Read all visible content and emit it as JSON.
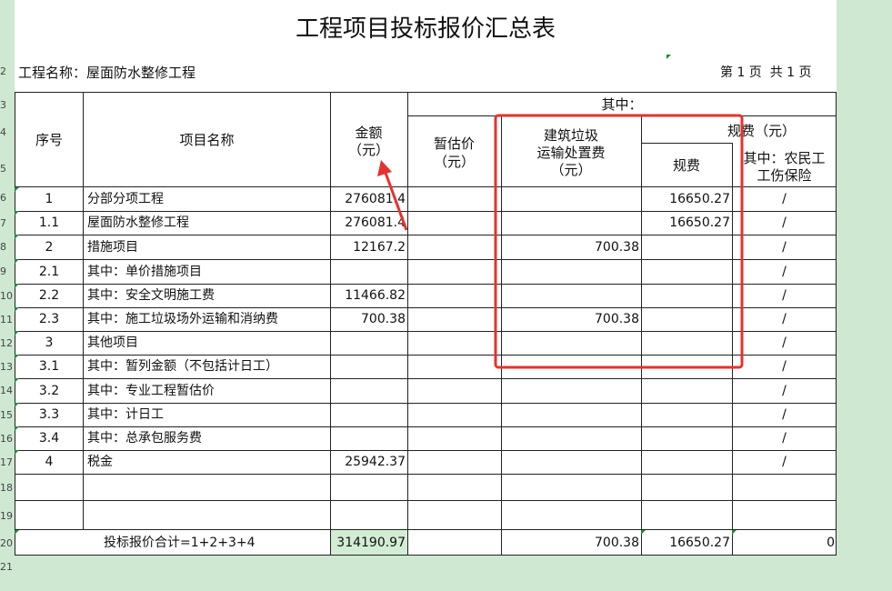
{
  "title": "工程项目投标报价汇总表",
  "project_name": "工程名称：屋面防水整修工程",
  "page_info": "第 1 页  共 1 页",
  "row_numbers": [
    "2",
    "3",
    "4",
    "5",
    "6",
    "7",
    "8",
    "9",
    "10",
    "11",
    "12",
    "13",
    "14",
    "15",
    "16",
    "17",
    "18",
    "19",
    "20",
    "21"
  ],
  "headers": {
    "seq": "序号",
    "item": "项目名称",
    "amount_l1": "金额",
    "amount_l2": "（元）",
    "among": "其中：",
    "provisional_l1": "暂估价",
    "provisional_l2": "（元）",
    "waste_l1": "建筑垃圾",
    "waste_l2": "运输处置费",
    "waste_l3": "（元）",
    "fees_group": "规费（元）",
    "fees": "规费",
    "injury_l1": "其中：农民工",
    "injury_l2": "工伤保险"
  },
  "rows": [
    {
      "seq": "1",
      "name": "分部分项工程",
      "amount": "276081.4",
      "prov": "",
      "waste": "",
      "fee": "16650.27",
      "inj": "/"
    },
    {
      "seq": "1.1",
      "name": "屋面防水整修工程",
      "amount": "276081.4",
      "prov": "",
      "waste": "",
      "fee": "16650.27",
      "inj": "/"
    },
    {
      "seq": "2",
      "name": "措施项目",
      "amount": "12167.2",
      "prov": "",
      "waste": "700.38",
      "fee": "",
      "inj": "/"
    },
    {
      "seq": "2.1",
      "name": "其中：单价措施项目",
      "amount": "",
      "prov": "",
      "waste": "",
      "fee": "",
      "inj": "/"
    },
    {
      "seq": "2.2",
      "name": "其中：安全文明施工费",
      "amount": "11466.82",
      "prov": "",
      "waste": "",
      "fee": "",
      "inj": "/"
    },
    {
      "seq": "2.3",
      "name": "其中：施工垃圾场外运输和消纳费",
      "amount": "700.38",
      "prov": "",
      "waste": "700.38",
      "fee": "",
      "inj": "/"
    },
    {
      "seq": "3",
      "name": "其他项目",
      "amount": "",
      "prov": "",
      "waste": "",
      "fee": "",
      "inj": "/"
    },
    {
      "seq": "3.1",
      "name": "其中：暂列金额（不包括计日工）",
      "amount": "",
      "prov": "",
      "waste": "",
      "fee": "",
      "inj": "/"
    },
    {
      "seq": "3.2",
      "name": "其中：专业工程暂估价",
      "amount": "",
      "prov": "",
      "waste": "",
      "fee": "",
      "inj": "/"
    },
    {
      "seq": "3.3",
      "name": "其中：计日工",
      "amount": "",
      "prov": "",
      "waste": "",
      "fee": "",
      "inj": "/"
    },
    {
      "seq": "3.4",
      "name": "其中：总承包服务费",
      "amount": "",
      "prov": "",
      "waste": "",
      "fee": "",
      "inj": "/"
    },
    {
      "seq": "4",
      "name": "税金",
      "amount": "25942.37",
      "prov": "",
      "waste": "",
      "fee": "",
      "inj": "/"
    },
    {
      "seq": "",
      "name": "",
      "amount": "",
      "prov": "",
      "waste": "",
      "fee": "",
      "inj": ""
    },
    {
      "seq": "",
      "name": "",
      "amount": "",
      "prov": "",
      "waste": "",
      "fee": "",
      "inj": ""
    }
  ],
  "total": {
    "label": "投标报价合计=1+2+3+4",
    "amount": "314190.97",
    "prov": "",
    "waste": "700.38",
    "fee": "16650.27",
    "inj": "0"
  },
  "colors": {
    "annotation": "#e5322d",
    "sheet_bg": "#cfe8d2",
    "total_cell_bg": "#d3ecd4"
  },
  "icons": [
    "arrow-annotation-icon",
    "red-highlight-box"
  ]
}
